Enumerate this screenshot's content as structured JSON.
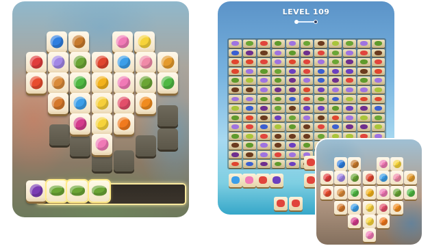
{
  "app": {
    "screens": [
      {
        "id": "left-board",
        "tray_items": [
          "eggplant-icon",
          "avocado-icon",
          "avocado-icon",
          "avocado-icon"
        ]
      },
      {
        "id": "level-board",
        "level_label": "LEVEL 109",
        "level_progress_fraction": 0.0
      },
      {
        "id": "small-preview-board"
      }
    ]
  },
  "icons": {
    "blueberry": "#2f7fe0",
    "cookie": "#c77a2c",
    "donut": "#f07ab6",
    "banana": "#f6d33a",
    "strawberry": "#e03c3c",
    "shell": "#a287e6",
    "avocado": "#6aa535",
    "tomato": "#e0452e",
    "cupcake": "#f08aa8",
    "croissant": "#e49a2c",
    "apple": "#e84c2e",
    "muffin": "#d98a3a",
    "pepper": "#4fb843",
    "fries": "#f3b21c",
    "burger": "#d4782b",
    "blue-candy": "#3c9ee8",
    "lemon": "#f6cf3c",
    "cake": "#e24f6a",
    "orange": "#f08b1e",
    "radish": "#d43c8c",
    "carrot": "#f07a1e",
    "swirl-candy": "#f07ab6",
    "eggplant": "#7b3db3",
    "watermelon": "#e0453c",
    "grapes": "#6b3fc0",
    "butterfly": "#9f73e0",
    "kiwi": "#5f9a2c",
    "pear": "#a9c43a",
    "chocolate": "#6b3b1f",
    "plum": "#6f2f8e",
    "berry": "#3b5fd0"
  }
}
